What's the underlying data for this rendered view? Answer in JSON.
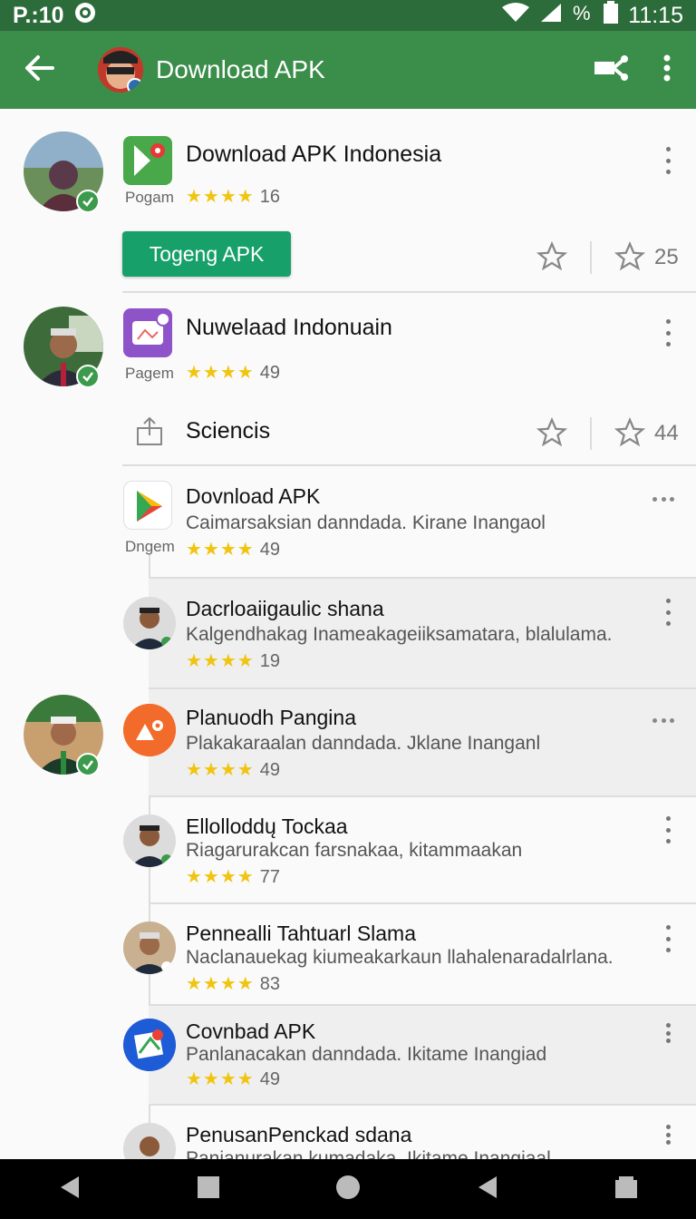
{
  "status_bar": {
    "left_text": "P.:10",
    "time": "11:15"
  },
  "app_bar": {
    "title": "Download APK"
  },
  "cards": [
    {
      "title": "Download APK Indonesia",
      "label": "Pogam",
      "stars": "★★★★",
      "count": "16",
      "button": "Togeng APK",
      "star_count": "25"
    },
    {
      "title": "Nuwelaad Indonuain",
      "label": "Pagem",
      "stars": "★★★★",
      "count": "49",
      "action_label": "Sciencis",
      "star_count": "44"
    }
  ],
  "list": [
    {
      "title": "Dovnload APK",
      "subtitle": "Caimarsaksian danndada. Kirane Inangaol",
      "label": "Dngem",
      "stars": "★★★★",
      "count": "49"
    },
    {
      "title": "Dacrloaiigaulic shana",
      "subtitle": "Kalgendhakag Inameakageiiksamatara, blalulama.",
      "stars": "★★★★",
      "count": "19"
    },
    {
      "title": "Planuodh Pangina",
      "subtitle": "Plakakaraalan danndada. Jklane Inanganl",
      "stars": "★★★★",
      "count": "49"
    },
    {
      "title": "Ellolloddų Tockaa",
      "subtitle": "Riagarurakcan farsnakaa, kitammaakan",
      "stars": "★★★★",
      "count": "77"
    },
    {
      "title": "Pennealli Tahtuarl Slama",
      "subtitle": "Naclanauekag kiumeakarkaun llahalenaradalrlana.",
      "stars": "★★★★",
      "count": "83"
    },
    {
      "title": "Covnbad APK",
      "subtitle": "Panlanacakan danndada. Ikitame Inangiad",
      "stars": "★★★★",
      "count": "49"
    },
    {
      "title": "PenusanPenckad sdana",
      "subtitle": "Panianurakan kumadaka. Ikitame Inangiaal"
    }
  ],
  "icons": {
    "back": "arrow-left-icon",
    "share": "share-icon",
    "more": "more-vert-icon",
    "star": "star-outline-icon",
    "check": "verified-check-icon"
  },
  "colors": {
    "app_bar": "#3b8d4a",
    "status_bar": "#2c6b3a",
    "button": "#18a06a",
    "star": "#f1c40f"
  }
}
